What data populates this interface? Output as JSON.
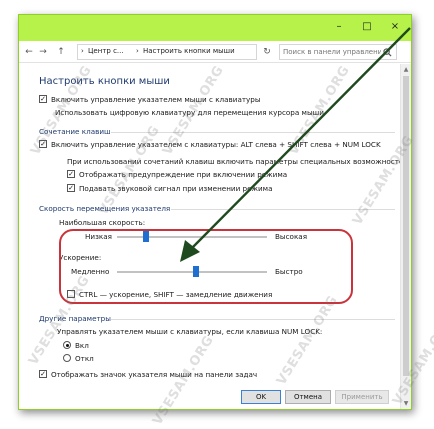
{
  "window": {
    "controls": {
      "minimize": "–",
      "maximize": "□",
      "close": "×"
    }
  },
  "addressbar": {
    "back": "←",
    "forward": "→",
    "up": "↑",
    "crumbs": [
      "Центр с...",
      "Настроить кнопки мыши"
    ],
    "separator": "›",
    "refresh": "↻",
    "search_placeholder": "Поиск в панели управления"
  },
  "page": {
    "title": "Настроить кнопки мыши",
    "enable_mousekeys": {
      "label": "Включить управление указателем мыши с клавиатуры",
      "checked": true
    },
    "numpad_hint": "Использовать цифровую клавиатуру для перемещения курсора мыши.",
    "shortcut_group": "Сочетание клавиш",
    "shortcut_enable": {
      "label": "Включить управление указателем с клавиатуры: ALT слева + SHIFT слева + NUM LOCK",
      "checked": true
    },
    "shortcut_hint": "При использовании сочетаний клавиш включить параметры специальных возможностей:",
    "show_warning": {
      "label": "Отображать предупреждение при включении режима",
      "checked": true
    },
    "play_sound": {
      "label": "Подавать звуковой сигнал при изменении режима",
      "checked": true
    },
    "speed_group": "Скорость перемещения указателя",
    "top_speed_label": "Наибольшая скорость:",
    "slow": "Низкая",
    "fast": "Высокая",
    "acceleration_label": "Ускорение:",
    "accel_slow": "Медленно",
    "accel_fast": "Быстро",
    "ctrl_shift": {
      "label": "CTRL — ускорение, SHIFT — замедление движения",
      "checked": false
    },
    "other_group": "Другие параметры",
    "numlock_hint": "Управлять указателем мыши с клавиатуры, если клавиша NUM LOCK:",
    "radio_on": {
      "label": "Вкл",
      "selected": true
    },
    "radio_off": {
      "label": "Откл",
      "selected": false
    },
    "show_taskbar_icon": {
      "label": "Отображать значок указателя мыши на панели задач",
      "checked": true
    }
  },
  "sliders": {
    "top_speed": 0.18,
    "acceleration": 0.53
  },
  "buttons": {
    "ok": "OK",
    "cancel": "Отмена",
    "apply": "Применить"
  },
  "watermark": "VSESAM.ORG",
  "colors": {
    "titlebar": "#b6f24a",
    "highlight": "#c9343c",
    "slider_thumb": "#1f6fd1",
    "arrow": "#1f4a1f"
  }
}
